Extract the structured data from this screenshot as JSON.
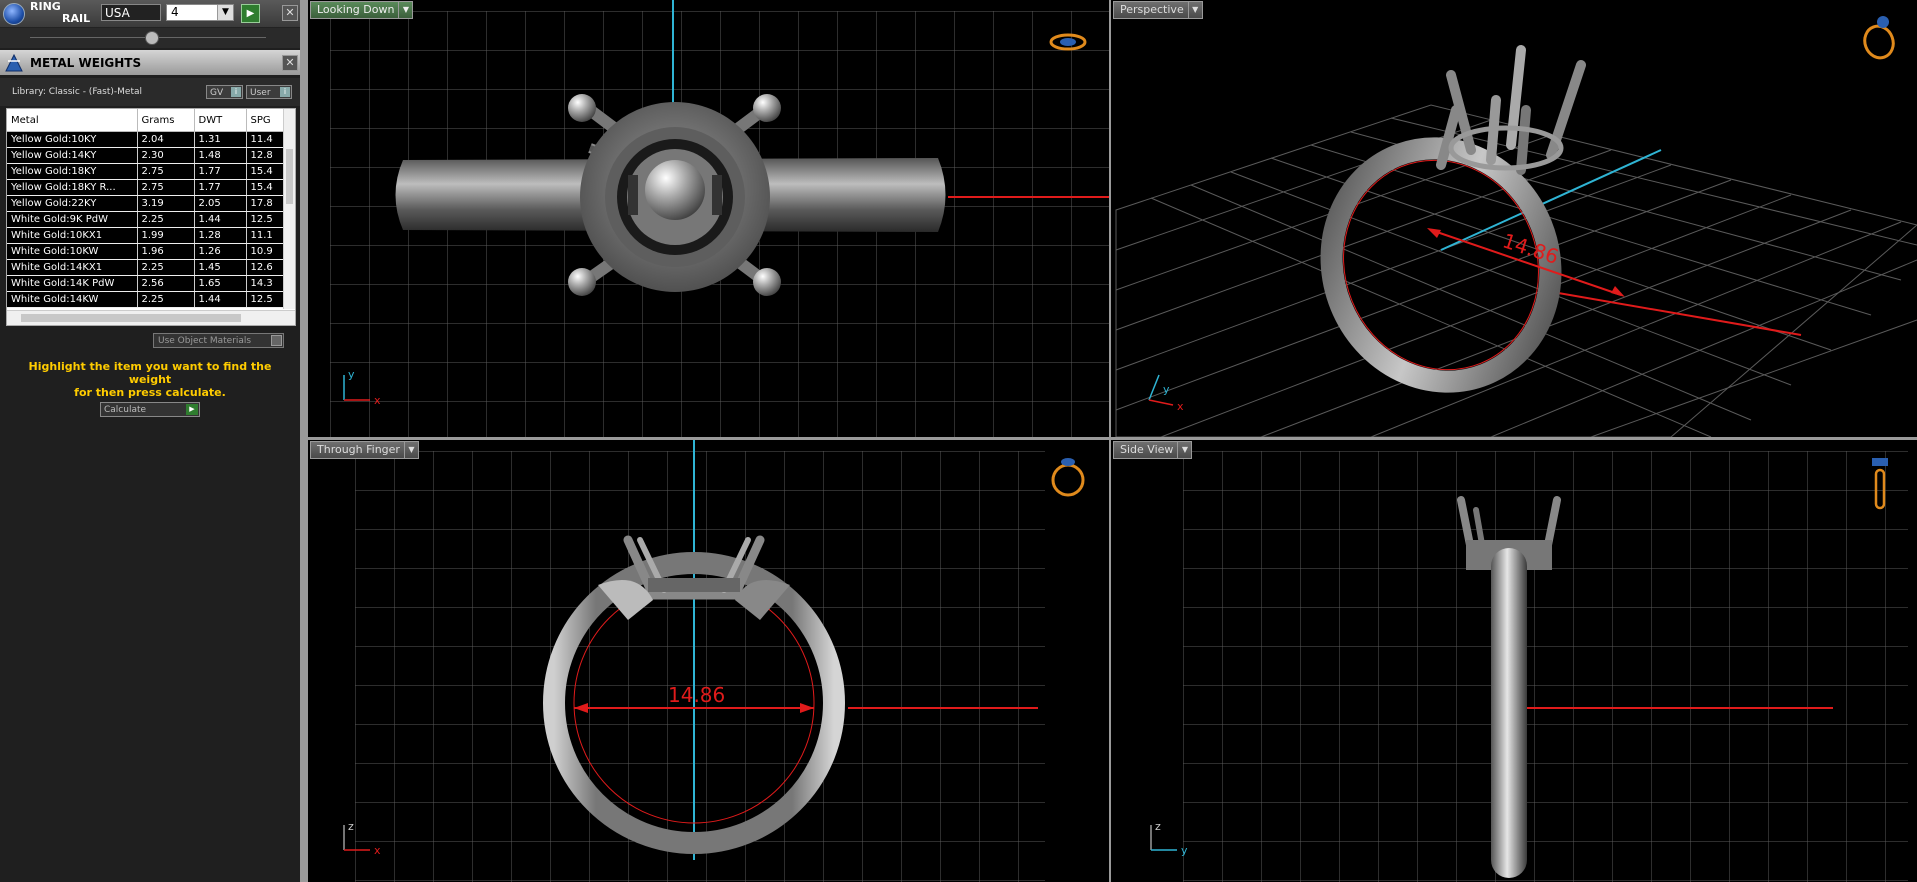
{
  "ring_rail": {
    "title_line1": "RING",
    "title_line2": "RAIL",
    "country": "USA",
    "size": "4",
    "go": "▶",
    "close": "✕"
  },
  "metal_weights": {
    "title": "METAL WEIGHTS",
    "close": "✕",
    "library": "Library: Classic - (Fast)-Metal",
    "gv_label": "GV",
    "user_label": "User",
    "columns": [
      "Metal",
      "Grams",
      "DWT",
      "SPG"
    ],
    "rows": [
      [
        "Yellow Gold:10KY",
        "2.04",
        "1.31",
        "11.4"
      ],
      [
        "Yellow Gold:14KY",
        "2.30",
        "1.48",
        "12.8"
      ],
      [
        "Yellow Gold:18KY",
        "2.75",
        "1.77",
        "15.4"
      ],
      [
        "Yellow Gold:18KY R...",
        "2.75",
        "1.77",
        "15.4"
      ],
      [
        "Yellow Gold:22KY",
        "3.19",
        "2.05",
        "17.8"
      ],
      [
        "White Gold:9K PdW",
        "2.25",
        "1.44",
        "12.5"
      ],
      [
        "White Gold:10KX1",
        "1.99",
        "1.28",
        "11.1"
      ],
      [
        "White Gold:10KW",
        "1.96",
        "1.26",
        "10.9"
      ],
      [
        "White Gold:14KX1",
        "2.25",
        "1.45",
        "12.6"
      ],
      [
        "White Gold:14K PdW",
        "2.56",
        "1.65",
        "14.3"
      ],
      [
        "White Gold:14KW",
        "2.25",
        "1.44",
        "12.5"
      ]
    ],
    "use_object_materials": "Use Object Materials",
    "hint_line1": "Highlight the item you want to find the weight",
    "hint_line2": "for then press calculate.",
    "calculate": "Calculate"
  },
  "viewports": {
    "top_left": {
      "label": "Looking Down"
    },
    "top_right": {
      "label": "Perspective",
      "measure": "14.86"
    },
    "bottom_left": {
      "label": "Through Finger",
      "measure": "14.86"
    },
    "bottom_right": {
      "label": "Side View"
    }
  },
  "axis_labels": {
    "x": "x",
    "y": "y",
    "z": "z"
  },
  "colors": {
    "accent_axis_blue": "#2fb4d4",
    "measure_red": "#e01b1b",
    "highlight_yellow": "#ffcc00",
    "icon_orange": "#e08a1c"
  }
}
